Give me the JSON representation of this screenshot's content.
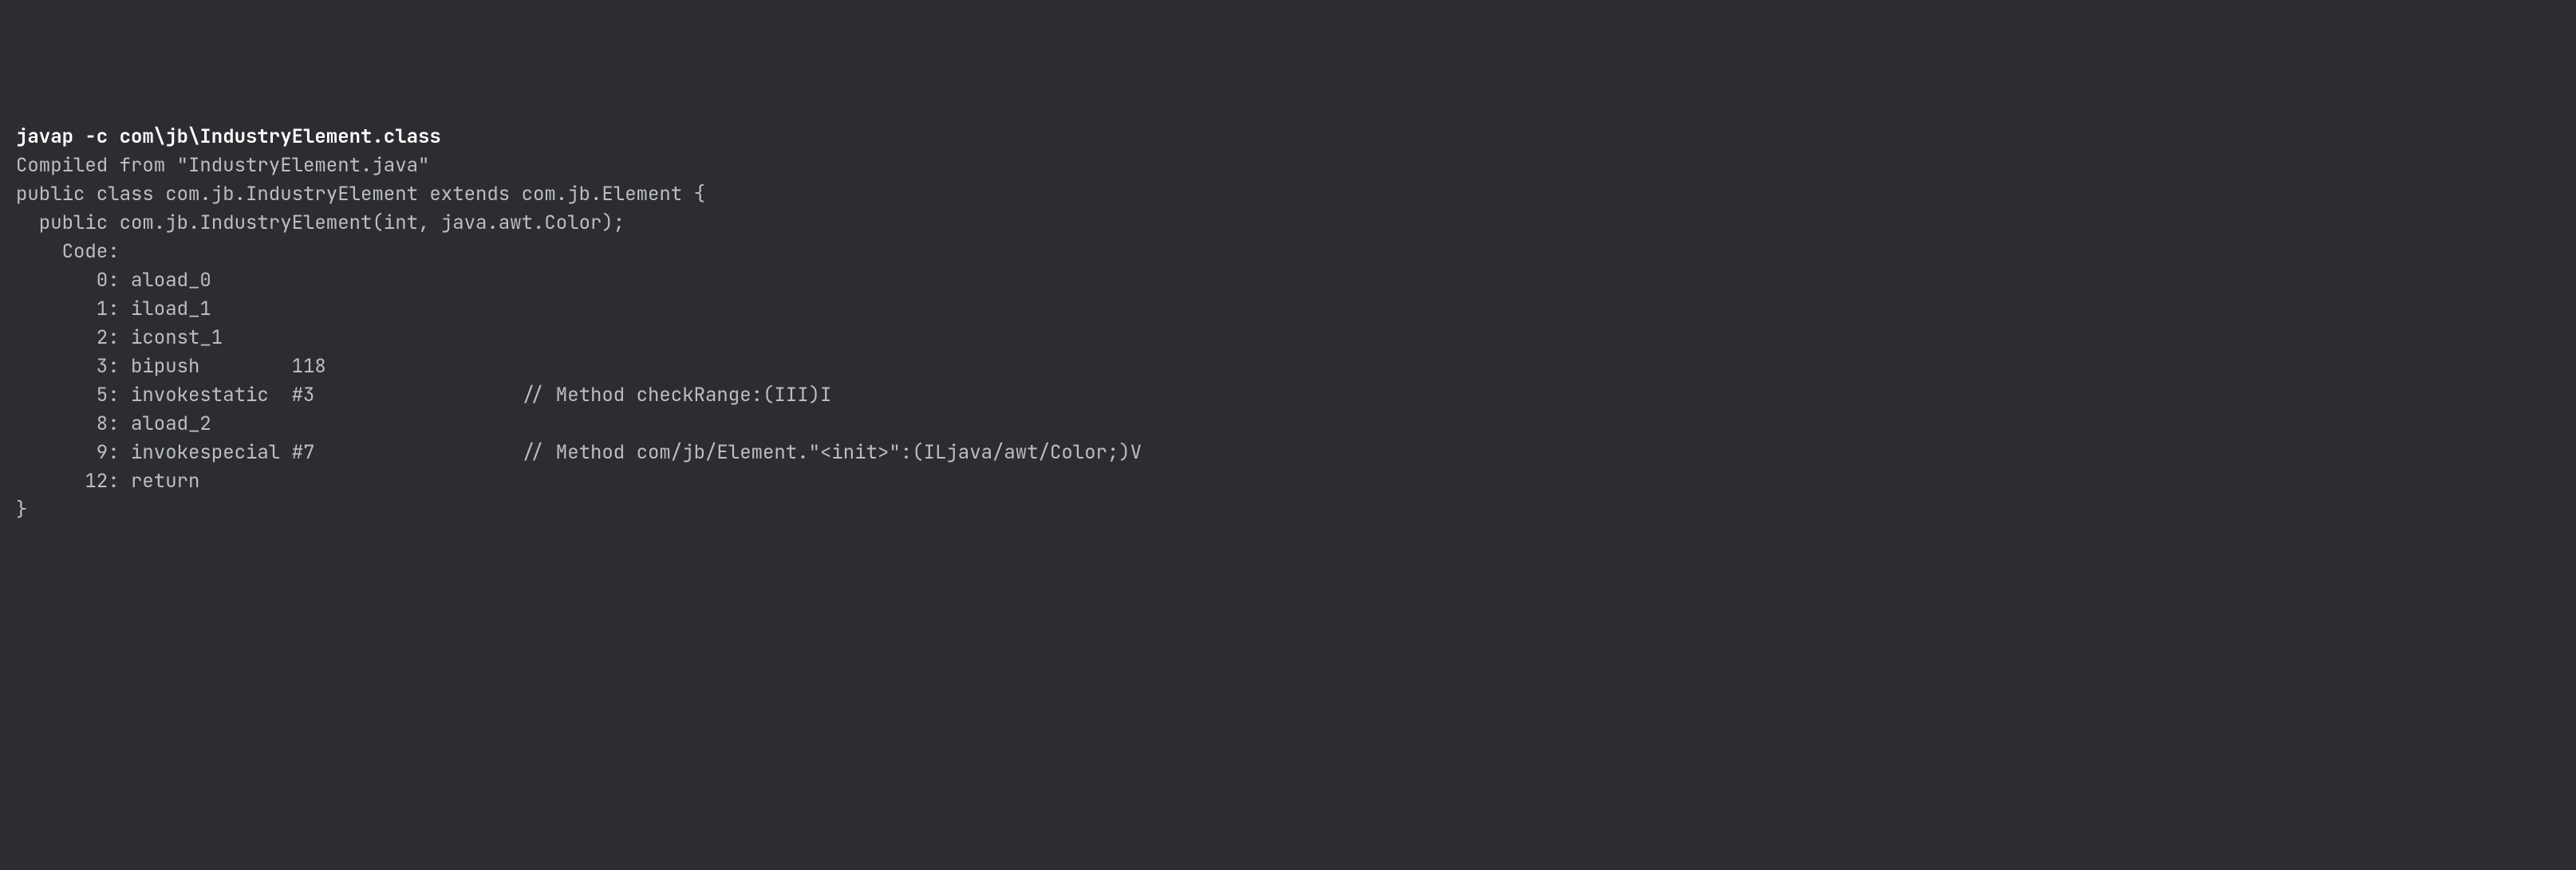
{
  "command": "javap -c com\\jb\\IndustryElement.class",
  "lines": [
    "Compiled from \"IndustryElement.java\"",
    "public class com.jb.IndustryElement extends com.jb.Element {",
    "  public com.jb.IndustryElement(int, java.awt.Color);",
    "    Code:",
    "       0: aload_0",
    "       1: iload_1",
    "       2: iconst_1",
    "       3: bipush        118",
    "       5: invokestatic  #3                  // Method checkRange:(III)I",
    "       8: aload_2",
    "       9: invokespecial #7                  // Method com/jb/Element.\"<init>\":(ILjava/awt/Color;)V",
    "      12: return",
    "}"
  ]
}
